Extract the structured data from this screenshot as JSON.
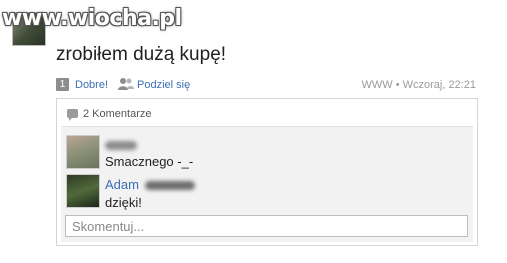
{
  "watermark": "www.wiocha.pl",
  "post": {
    "text": "zrobiłem dużą kupę!",
    "like_count": "1",
    "like_label": "Dobre!",
    "share_label": "Podziel się",
    "meta": "WWW • Wczoraj, 22:21"
  },
  "comments": {
    "header": "2 Komentarze",
    "items": [
      {
        "author": "",
        "text": "Smacznego -_-"
      },
      {
        "author": "Adam",
        "text": "dzięki!"
      }
    ],
    "input_placeholder": "Skomentuj..."
  },
  "colors": {
    "link": "#3b6fb6",
    "meta": "#9a9a9a",
    "panel_bg": "#f2f2f2",
    "border": "#d5d5d5"
  },
  "icons": [
    "share-people-icon",
    "comment-bubble-icon"
  ]
}
